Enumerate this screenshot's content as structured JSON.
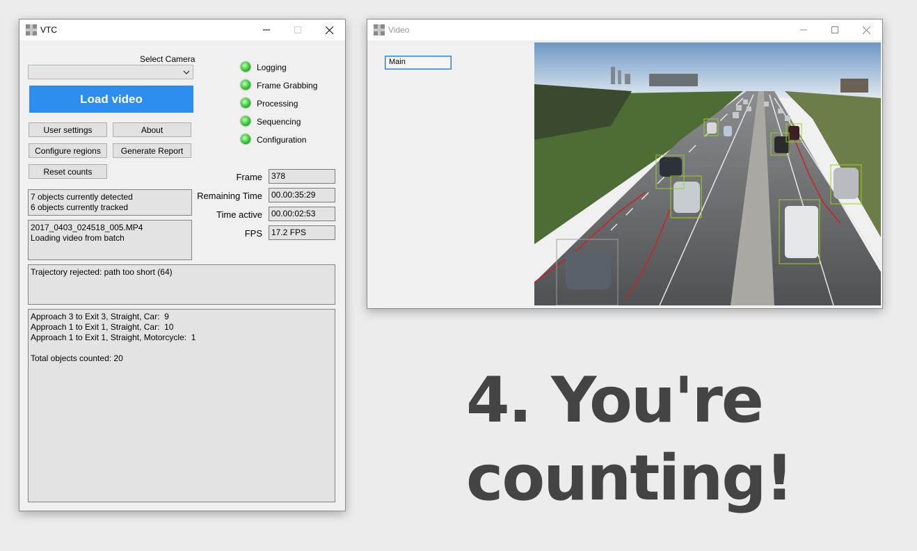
{
  "vtc_window": {
    "title": "VTC",
    "select_camera_label": "Select Camera",
    "camera_selected": "",
    "load_video_label": "Load video",
    "buttons": {
      "user_settings": "User settings",
      "about": "About",
      "configure_regions": "Configure regions",
      "generate_report": "Generate Report",
      "reset_counts": "Reset counts"
    },
    "status_lights": [
      {
        "label": "Logging",
        "color": "#2fd12f"
      },
      {
        "label": "Frame Grabbing",
        "color": "#2fd12f"
      },
      {
        "label": "Processing",
        "color": "#2fd12f"
      },
      {
        "label": "Sequencing",
        "color": "#2fd12f"
      },
      {
        "label": "Configuration",
        "color": "#2fd12f"
      }
    ],
    "detection_box": "7 objects currently detected\n6 objects currently tracked",
    "file_box": "2017_0403_024518_005.MP4\nLoading video from batch",
    "stats": {
      "frame_label": "Frame",
      "frame_value": "378",
      "remaining_label": "Remaining Time",
      "remaining_value": "00.00:35:29",
      "active_label": "Time active",
      "active_value": "00.00:02:53",
      "fps_label": "FPS",
      "fps_value": "17.2 FPS"
    },
    "trajectory_box": "Trajectory rejected: path too short (64)",
    "counts_box": "Approach 3 to Exit 3, Straight, Car:  9\nApproach 1 to Exit 1, Straight, Car:  10\nApproach 1 to Exit 1, Straight, Motorcycle:  1\n\nTotal objects counted: 20"
  },
  "video_window": {
    "title": "Video",
    "view_tag": "Main"
  },
  "headline": {
    "line1": "4. You're",
    "line2": "counting!"
  }
}
